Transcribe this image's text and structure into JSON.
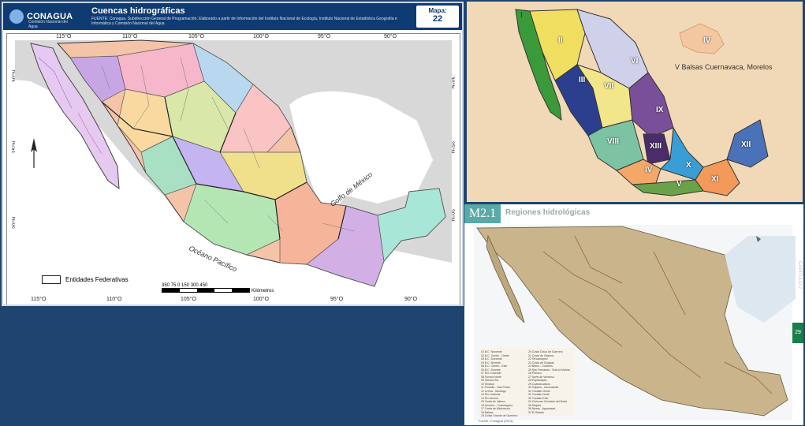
{
  "panel1": {
    "logo_text": "CONAGUA",
    "logo_sub": "Comisión Nacional del Agua",
    "title": "Cuencas hidrográficas",
    "source": "FUENTE: Conagua. Subdirección General de Programación. Elaborado a partir de Información del Instituto Nacional de Ecología, Instituto Nacional de Estadística Geografía e Informática y Comisión Nacional del Agua",
    "map_label": "Mapa:",
    "map_number": "22",
    "top_ticks": [
      "115°O",
      "110°O",
      "105°O",
      "100°O",
      "95°O",
      "90°O"
    ],
    "bottom_ticks": [
      "115°O",
      "110°O",
      "105°O",
      "100°O",
      "95°O",
      "90°O"
    ],
    "left_ticks": [
      "30°N",
      "25°N",
      "20°N"
    ],
    "right_ticks": [
      "30°N",
      "25°N",
      "20°N"
    ],
    "legend_label": "Entidades Federativas",
    "scale_ticks": "350  75  0  150  300  450",
    "scale_unit": "Kilómetros",
    "gulf_label": "Golfo de México",
    "ocean_label": "Océano Pacífico"
  },
  "panel2": {
    "regions": [
      "I",
      "II",
      "III",
      "IV",
      "V",
      "VI",
      "VII",
      "VIII",
      "IX",
      "X",
      "XI",
      "XII",
      "XIII",
      "IV"
    ],
    "inset_label": "IV",
    "inset_caption": "V Balsas Cuernavaca, Morelos"
  },
  "panel3": {
    "code": "M2.1",
    "title": "Regiones hidrológicas",
    "tab_number": "29",
    "side_text": "CAPÍTULO 2",
    "legend_lines": [
      "01 B.C. Noroeste",
      "02 B.C. Centro - Oeste",
      "03 B.C. Suroeste",
      "04 B.C. Noreste",
      "05 B.C. Centro - Este",
      "06 B.C. Sureste",
      "07 Río Colorado",
      "08 Sonora Norte",
      "09 Sonora Sur",
      "10 Sinaloa",
      "11 Presidio - San Pedro",
      "12 Lerma - Santiago",
      "13 Río Huicicila",
      "14 Río Ameca",
      "15 Costa de Jalisco",
      "16 Armería - Coahuayana",
      "17 Costa de Michoacán",
      "18 Balsas",
      "19 Costa Grande de Guerrero",
      "20 Costa Chica de Guerrero",
      "21 Costa de Oaxaca",
      "22 Tehuantepec",
      "23 Costa de Chiapas",
      "24 Bravo - Conchos",
      "25 San Fernando - Soto la Marina",
      "26 Pánuco",
      "27 Norte de Veracruz",
      "28 Papaloapan",
      "29 Coatzacoalcos",
      "30 Grijalva - Usumacinta",
      "31 Yucatán Oeste",
      "32 Yucatán Norte",
      "33 Yucatán Este",
      "34 Cuencas Cerradas del Norte",
      "35 Mapimí",
      "36 Nazas - Aguanaval",
      "37 El Salado"
    ],
    "fuente": "Fuente: Conagua (2014)."
  },
  "colors": {
    "background": "#1f4470",
    "header": "#0f3b73",
    "accent_teal": "#59a9a8",
    "tab_green": "#1a7d4a",
    "sand": "#f1d9b7"
  }
}
